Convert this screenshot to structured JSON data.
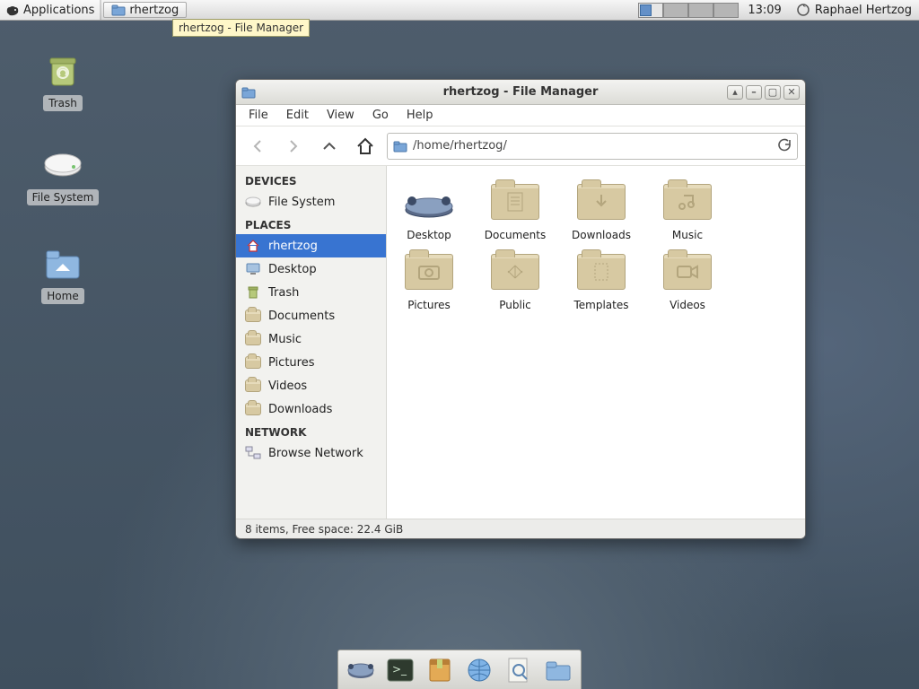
{
  "panel": {
    "applications": "Applications",
    "task_label": "rhertzog",
    "tooltip": "rhertzog - File Manager",
    "clock": "13:09",
    "user": "Raphael Hertzog"
  },
  "desktop": {
    "trash": "Trash",
    "filesystem": "File System",
    "home": "Home"
  },
  "window": {
    "title": "rhertzog - File Manager",
    "menus": [
      "File",
      "Edit",
      "View",
      "Go",
      "Help"
    ],
    "path": "/home/rhertzog/",
    "sidebar": {
      "devices_hdr": "DEVICES",
      "devices": [
        "File System"
      ],
      "places_hdr": "PLACES",
      "places": [
        "rhertzog",
        "Desktop",
        "Trash",
        "Documents",
        "Music",
        "Pictures",
        "Videos",
        "Downloads"
      ],
      "network_hdr": "NETWORK",
      "network": [
        "Browse Network"
      ]
    },
    "items": [
      {
        "name": "Desktop",
        "glyph": "desktop"
      },
      {
        "name": "Documents",
        "glyph": "doc"
      },
      {
        "name": "Downloads",
        "glyph": "down"
      },
      {
        "name": "Music",
        "glyph": "music"
      },
      {
        "name": "Pictures",
        "glyph": "pic"
      },
      {
        "name": "Public",
        "glyph": "public"
      },
      {
        "name": "Templates",
        "glyph": "tmpl"
      },
      {
        "name": "Videos",
        "glyph": "vid"
      }
    ],
    "status": "8 items, Free space: 22.4 GiB"
  },
  "dock": [
    "files",
    "terminal",
    "archive",
    "web",
    "search",
    "folder"
  ]
}
